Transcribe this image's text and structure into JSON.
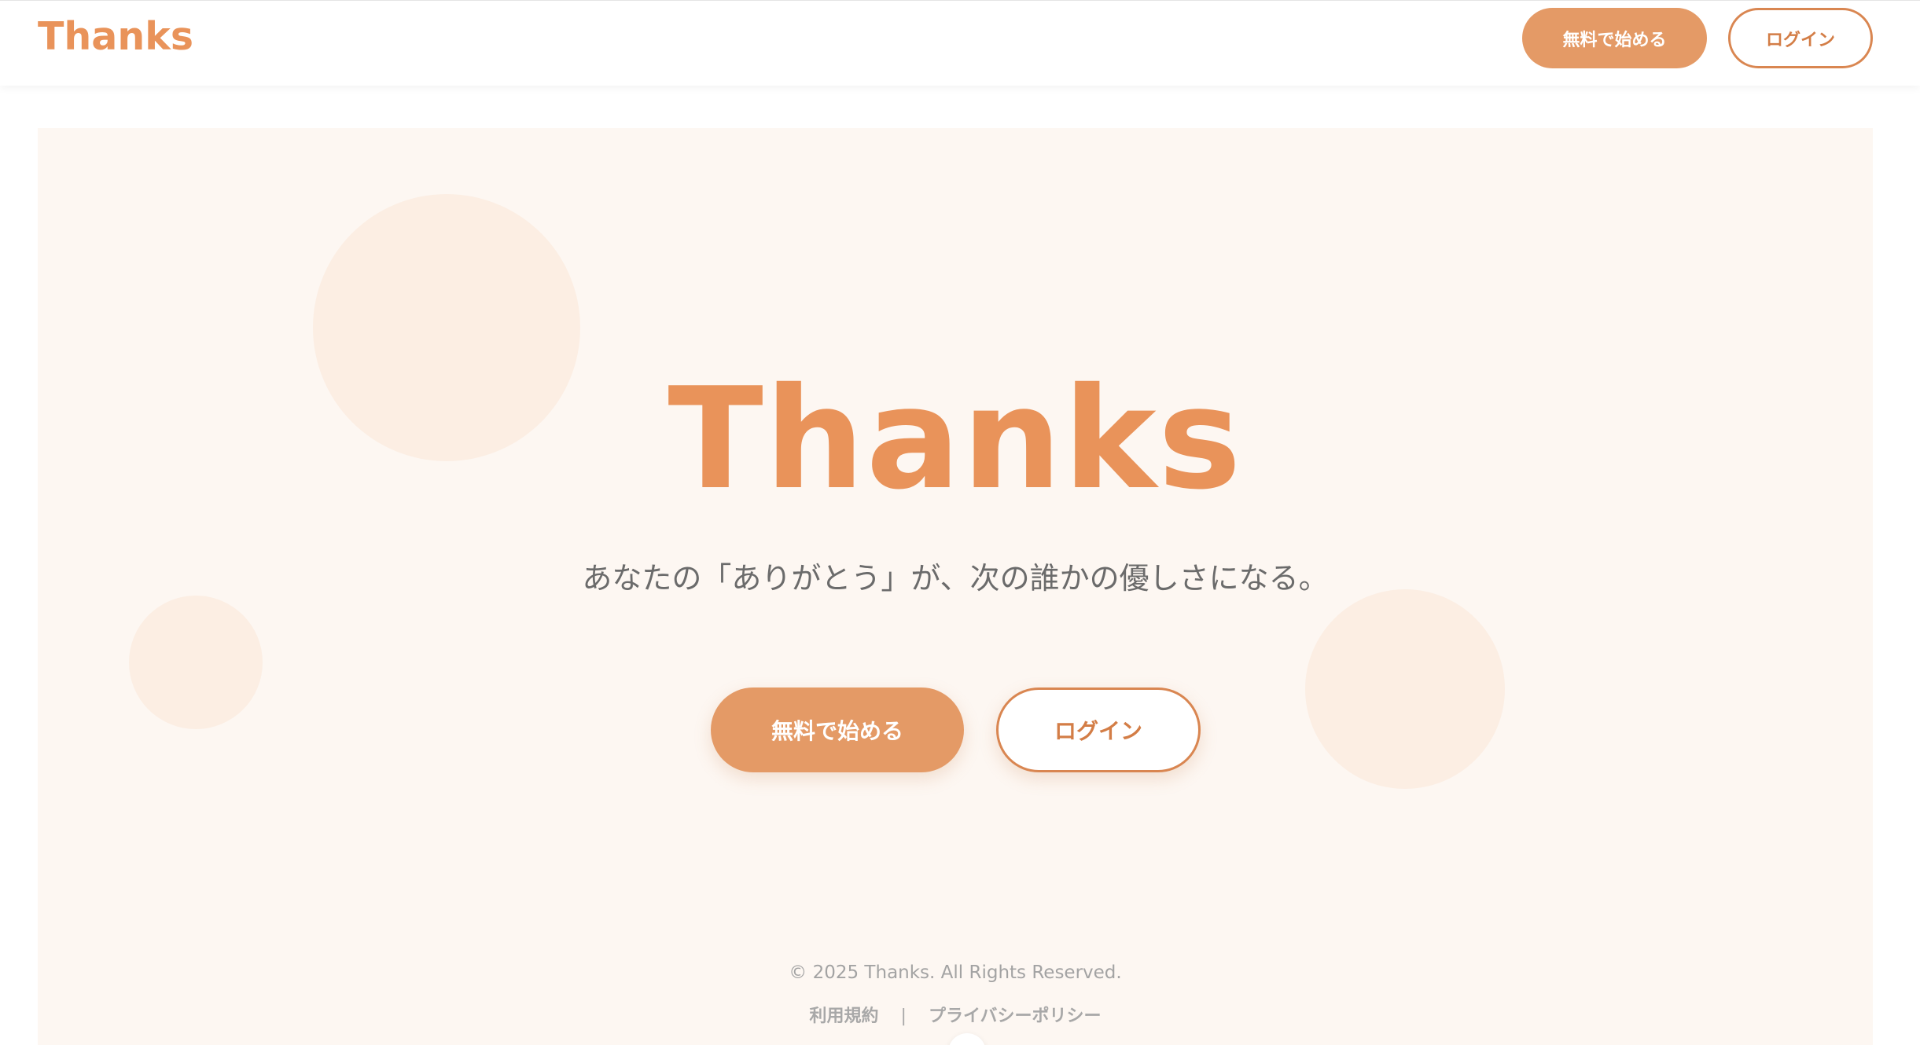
{
  "header": {
    "logo": "Thanks",
    "signup_label": "無料で始める",
    "login_label": "ログイン"
  },
  "hero": {
    "title": "Thanks",
    "tagline": "あなたの「ありがとう」が、次の誰かの優しさになる。",
    "signup_label": "無料で始める",
    "login_label": "ログイン"
  },
  "footer": {
    "copyright": "© 2025 Thanks. All Rights Reserved.",
    "terms_label": "利用規約",
    "separator": "|",
    "privacy_label": "プライバシーポリシー"
  },
  "colors": {
    "accent": "#e9935a",
    "button": "#e49a66",
    "hero_background": "#fdf7f2",
    "circle": "#fbece1"
  }
}
